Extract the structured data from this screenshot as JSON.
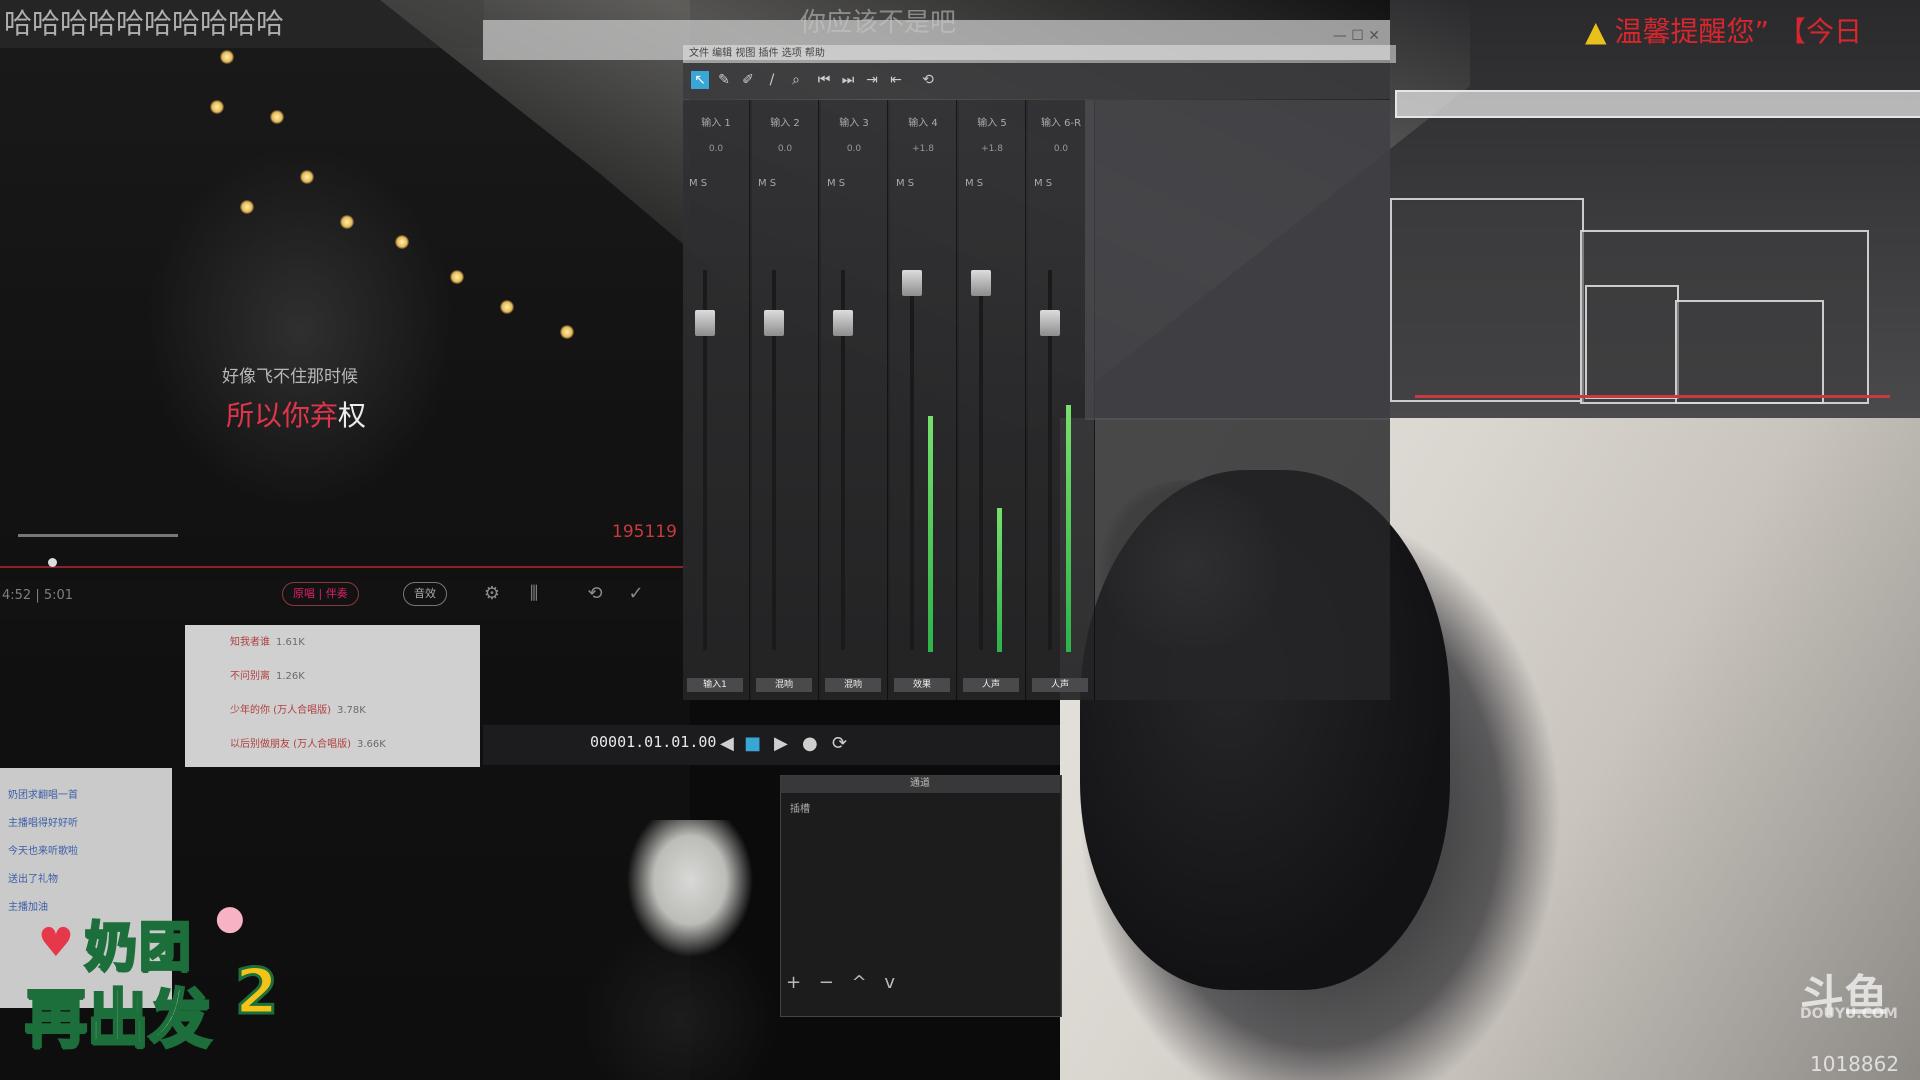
{
  "stream": {
    "title": "哈哈哈哈哈哈哈哈哈哈",
    "center_title": "你应该不是吧",
    "warning": "温馨提醒您” 【今日",
    "logo_line1": "奶团",
    "logo_line2": "再出发",
    "logo_number": "2",
    "platform": "斗鱼",
    "platform_sub": "DOUYU.COM",
    "room_id": "1018862"
  },
  "karaoke": {
    "lyric_prev": "好像飞不住那时候",
    "lyric_current_sung": "所以你弃",
    "lyric_current_unsung": "权",
    "score": "195119",
    "time": "4:52 | 5:01",
    "pill_1": "原唱 | 伴奏",
    "pill_2": "音效"
  },
  "daw": {
    "menu": "文件  编辑  视图  插件  选项  帮助",
    "channels": [
      {
        "name": "输入 1",
        "pan": "0.0",
        "label": "输入1",
        "level": 0.0
      },
      {
        "name": "输入 2",
        "pan": "0.0",
        "label": "混响",
        "level": 0.0
      },
      {
        "name": "输入 3",
        "pan": "0.0",
        "label": "混响",
        "level": 0.0
      },
      {
        "name": "输入 4",
        "pan": "+1.8",
        "label": "效果",
        "level": 0.62
      },
      {
        "name": "输入 5",
        "pan": "+1.8",
        "label": "人声",
        "level": 0.38
      },
      {
        "name": "输入 6-R",
        "pan": "0.0",
        "label": "人声",
        "level": 0.65
      }
    ],
    "timecode": "00001.01.01.00",
    "fx_header": "通道",
    "fx_row": "插槽",
    "fx_controls": "+ − ^ v"
  },
  "songs": [
    {
      "title": "知我者谁",
      "count": "1.61K"
    },
    {
      "title": "不问别离",
      "count": "1.26K"
    },
    {
      "title": "少年的你 (万人合唱版)",
      "count": "3.78K"
    },
    {
      "title": "以后别做朋友 (万人合唱版)",
      "count": "3.66K"
    }
  ],
  "chat": [
    "奶团求翻唱一首",
    "主播唱得好好听",
    "今天也来听歌啦",
    "送出了礼物",
    "主播加油"
  ],
  "colors": {
    "accent_red": "#d7262e",
    "meter_green": "#2db34a",
    "logo_green": "#1c6e3a",
    "logo_yellow": "#f2c318"
  }
}
